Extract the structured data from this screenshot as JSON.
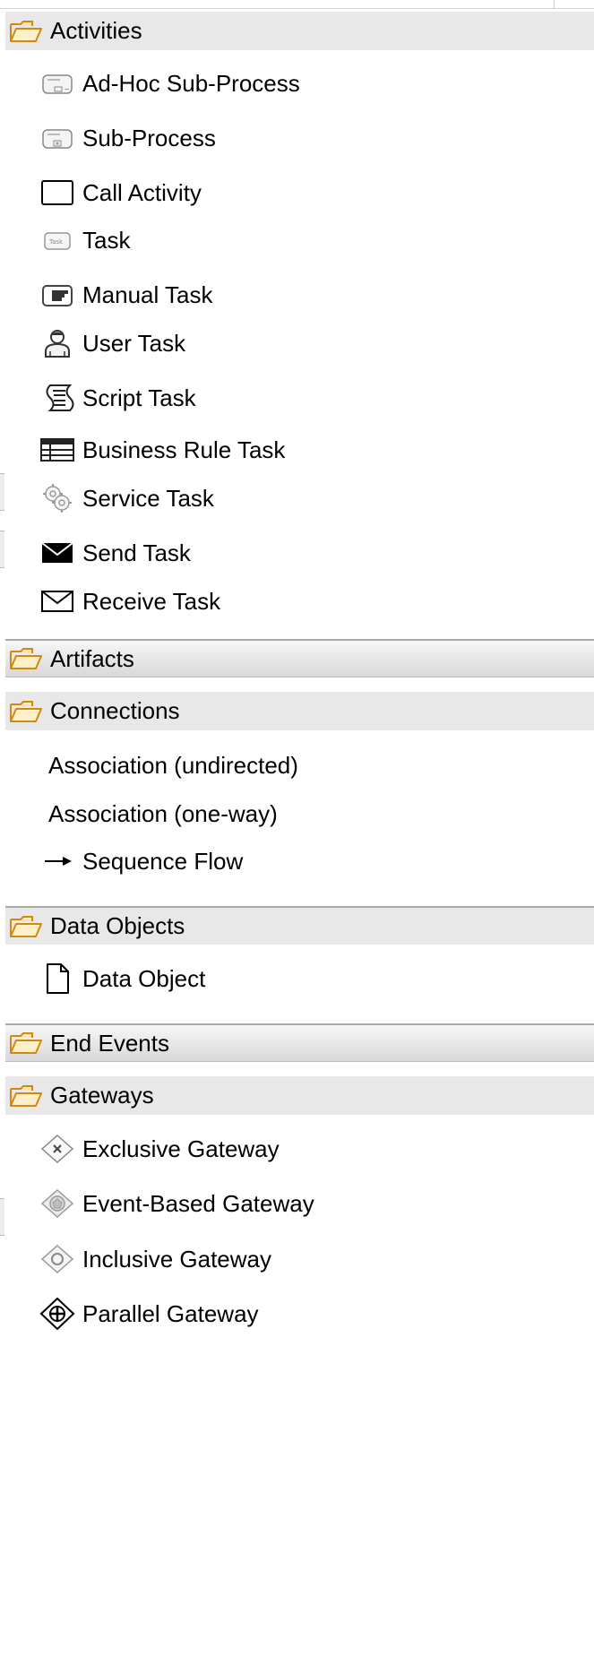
{
  "palette": {
    "activities": {
      "label": "Activities",
      "items": [
        {
          "label": "Ad-Hoc Sub-Process",
          "icon": "adhoc-subprocess-icon"
        },
        {
          "label": "Sub-Process",
          "icon": "subprocess-icon"
        },
        {
          "label": "Call Activity",
          "icon": "call-activity-icon"
        },
        {
          "label": "Task",
          "icon": "task-icon"
        },
        {
          "label": "Manual Task",
          "icon": "manual-task-icon"
        },
        {
          "label": "User Task",
          "icon": "user-task-icon"
        },
        {
          "label": "Script Task",
          "icon": "script-task-icon"
        },
        {
          "label": "Business Rule Task",
          "icon": "business-rule-task-icon"
        },
        {
          "label": "Service Task",
          "icon": "service-task-icon"
        },
        {
          "label": "Send Task",
          "icon": "send-task-icon"
        },
        {
          "label": "Receive Task",
          "icon": "receive-task-icon"
        }
      ]
    },
    "artifacts": {
      "label": "Artifacts"
    },
    "connections": {
      "label": "Connections",
      "items": [
        {
          "label": "Association (undirected)"
        },
        {
          "label": "Association (one-way)"
        },
        {
          "label": "Sequence Flow",
          "icon": "sequence-flow-arrow-icon"
        }
      ]
    },
    "data_objects": {
      "label": "Data Objects",
      "items": [
        {
          "label": "Data Object",
          "icon": "data-object-icon"
        }
      ]
    },
    "end_events": {
      "label": "End Events"
    },
    "gateways": {
      "label": "Gateways",
      "items": [
        {
          "label": "Exclusive Gateway",
          "icon": "exclusive-gateway-icon"
        },
        {
          "label": "Event-Based Gateway",
          "icon": "event-based-gateway-icon"
        },
        {
          "label": "Inclusive Gateway",
          "icon": "inclusive-gateway-icon"
        },
        {
          "label": "Parallel Gateway",
          "icon": "parallel-gateway-icon"
        }
      ]
    },
    "colors": {
      "open_drawer_bg": "#e8e8e8",
      "closed_drawer_bg": "#dedede",
      "folder_stroke": "#d08a12",
      "folder_fill": "#fbe6b0"
    }
  }
}
